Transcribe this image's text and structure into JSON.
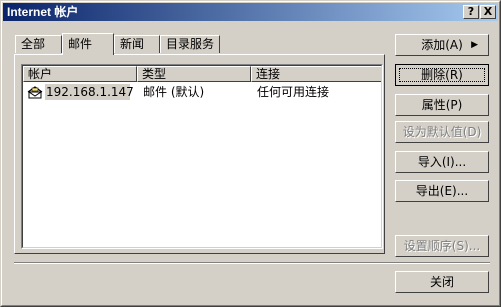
{
  "window": {
    "title": "Internet 帐户",
    "help_button": "?",
    "close_button": "X"
  },
  "tabs": [
    {
      "label": "全部"
    },
    {
      "label": "邮件"
    },
    {
      "label": "新闻"
    },
    {
      "label": "目录服务"
    }
  ],
  "active_tab": "邮件",
  "list": {
    "columns": [
      "帐户",
      "类型",
      "连接"
    ],
    "rows": [
      {
        "account": "192.168.1.147",
        "type": "邮件 (默认)",
        "connection": "任何可用连接",
        "icon": "mail-account-icon"
      }
    ]
  },
  "buttons": {
    "add": "添加(A)",
    "remove": "删除(R)",
    "properties": "属性(P)",
    "set_default": "设为默认值(D)",
    "import": "导入(I)...",
    "export": "导出(E)...",
    "set_order": "设置顺序(S)...",
    "close": "关闭"
  },
  "colors": {
    "face": "#d4d0c8",
    "titlebar_start": "#0a246a",
    "titlebar_end": "#a6caf0",
    "selection": "#d4d0c8"
  }
}
